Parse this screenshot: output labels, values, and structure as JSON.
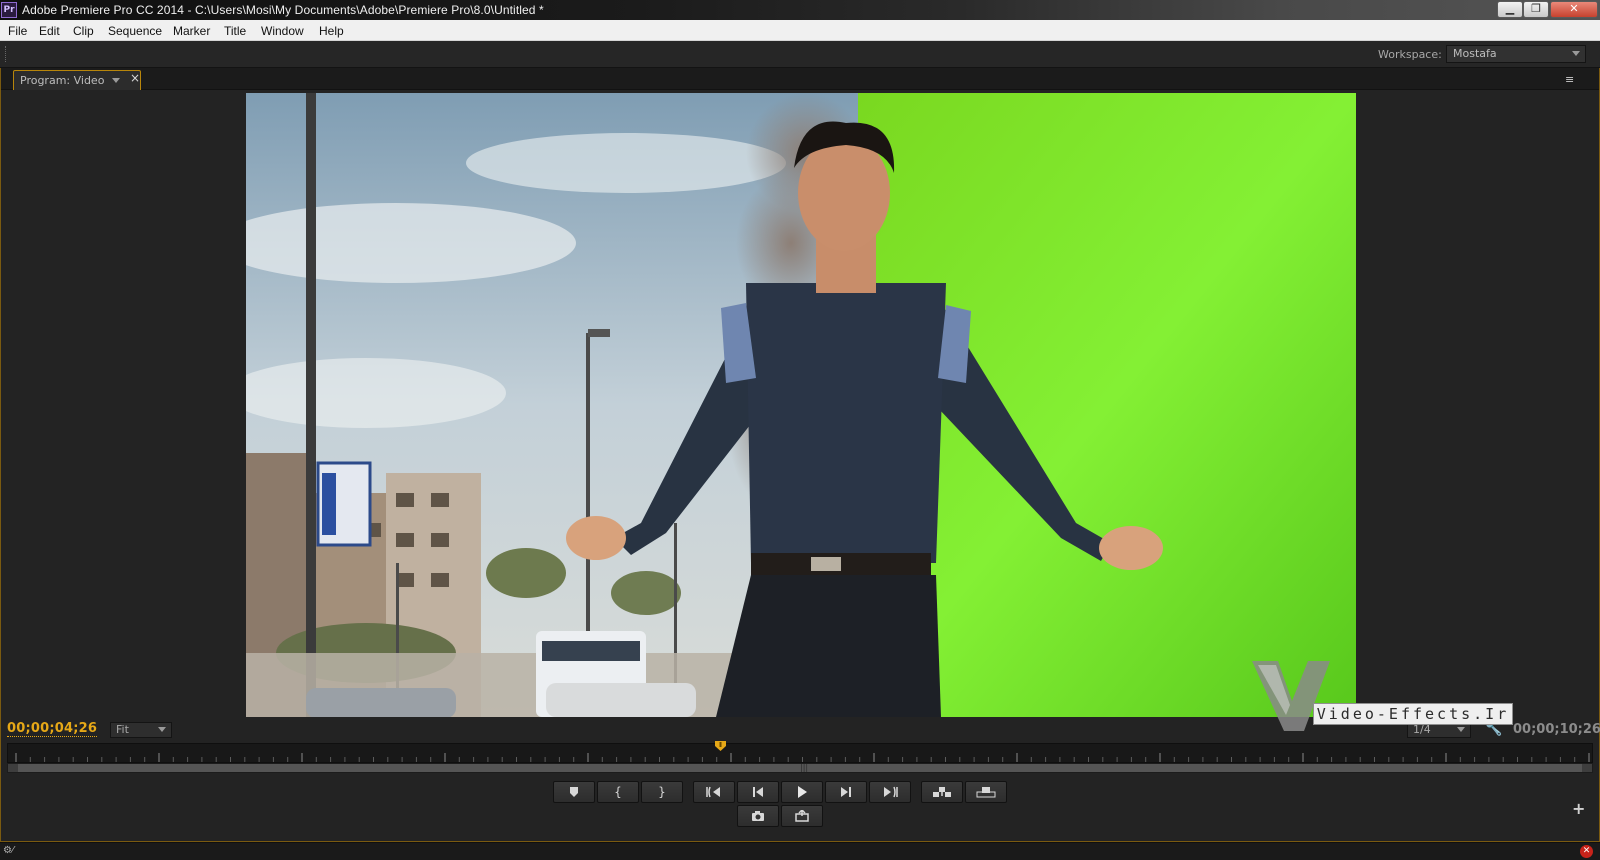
{
  "window": {
    "app_icon": "Pr",
    "title": "Adobe Premiere Pro CC 2014 - C:\\Users\\Mosi\\My Documents\\Adobe\\Premiere Pro\\8.0\\Untitled *",
    "minimize_icon": "minimize-icon",
    "restore_icon": "restore-icon",
    "close_icon": "close-icon"
  },
  "menu": [
    "File",
    "Edit",
    "Clip",
    "Sequence",
    "Marker",
    "Title",
    "Window",
    "Help"
  ],
  "workspace": {
    "label": "Workspace:",
    "value": "Mostafa"
  },
  "panel": {
    "tab_label": "Program: Video",
    "close_glyph": "×",
    "menu_glyph": "≡"
  },
  "monitor": {
    "current_timecode": "00;00;04;26",
    "duration_timecode": "00;00;10;26",
    "zoom": "Fit",
    "resolution": "1/4",
    "playhead_position": 0.45
  },
  "transport": {
    "row1": [
      "add-marker",
      "mark-in",
      "mark-out",
      "go-to-in",
      "step-back",
      "play",
      "step-forward",
      "go-to-out",
      "insert",
      "overwrite"
    ],
    "row2": [
      "export-frame",
      "button-editor"
    ]
  },
  "watermark": {
    "text": "Video-Effects.Ir"
  },
  "colors": {
    "accent": "#e6a817",
    "panel_border": "#7a5a10",
    "green_screen": "#6fe020"
  }
}
